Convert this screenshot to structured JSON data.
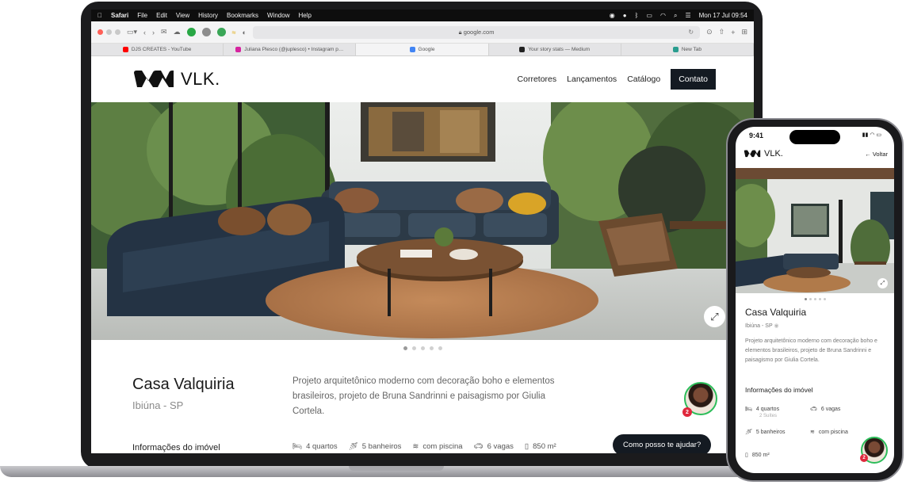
{
  "menubar": {
    "apple": "",
    "items": [
      "Safari",
      "File",
      "Edit",
      "View",
      "History",
      "Bookmarks",
      "Window",
      "Help"
    ],
    "datetime": "Mon 17 Jul  09:54"
  },
  "browser": {
    "url": "google.com",
    "tabs": [
      {
        "label": "DJS CREATES - YouTube",
        "color": "#ff0000"
      },
      {
        "label": "Juliana Plesco (@juplesco) • Instagram p…",
        "color": "#d6249f"
      },
      {
        "label": "Google",
        "color": "#4285f4"
      },
      {
        "label": "Your story stats — Medium",
        "color": "#222222"
      },
      {
        "label": "New Tab",
        "color": "#2a9d8f"
      }
    ]
  },
  "site": {
    "logo_text": "VLK.",
    "nav": [
      "Corretores",
      "Lançamentos",
      "Catálogo"
    ],
    "cta": "Contato"
  },
  "property": {
    "title": "Casa Valquiria",
    "location": "Ibiúna - SP",
    "description": "Projeto arquitetônico moderno com decoração boho e elementos brasileiros, projeto de Bruna Sandrinni e paisagismo por Giulia Cortela.",
    "info_heading": "Informações do imóvel",
    "features": {
      "bedrooms": "4 quartos",
      "bathrooms": "5 banheiros",
      "pool": "com piscina",
      "parking": "6 vagas",
      "area": "850 m²"
    },
    "carousel_count": 5
  },
  "chat": {
    "badge": "2",
    "button": "Como posso te ajudar?"
  },
  "phone": {
    "time": "9:41",
    "back": "Voltar",
    "logo_text": "VLK.",
    "title": "Casa Valquiria",
    "location": "Ibiúna - SP",
    "description": "Projeto arquitetônico moderno com decoração boho e elementos brasileiros, projeto de Bruna Sandrinni e paisagismo por Giulia Cortela.",
    "info_heading": "Informações do imóvel",
    "bedrooms": "4 quartos",
    "suites": "2 Suítes",
    "parking": "6 vagas",
    "bathrooms": "5 banheiros",
    "pool": "com piscina",
    "area": "850 m²",
    "badge": "2"
  },
  "colors": {
    "primary_dark": "#141a22",
    "online_green": "#2dbd5a",
    "badge_red": "#e0283c"
  }
}
